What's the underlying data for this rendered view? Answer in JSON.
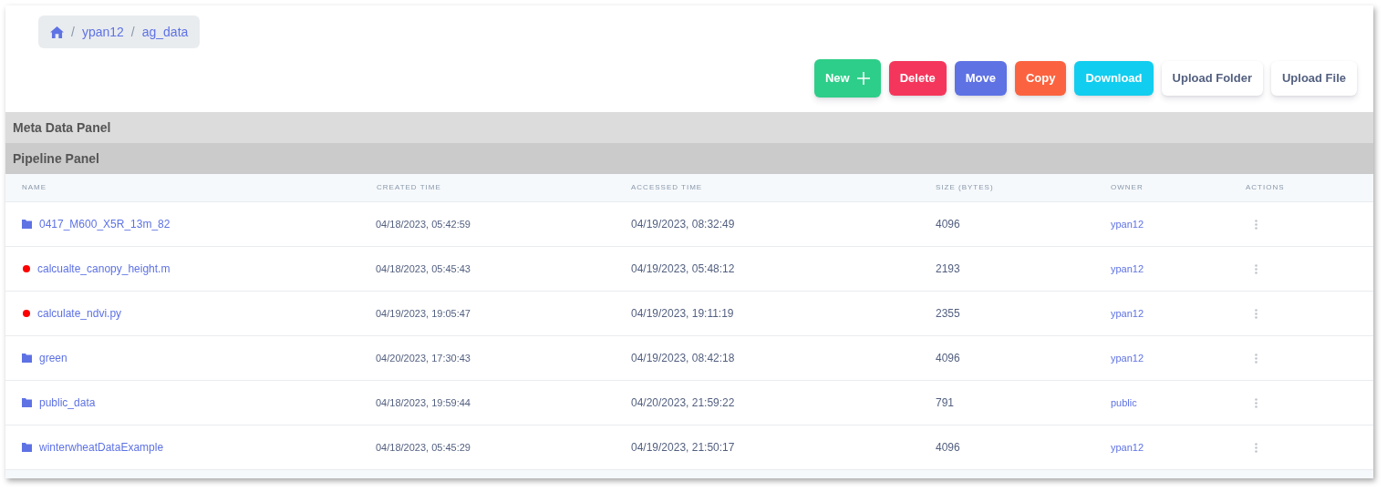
{
  "breadcrumb": {
    "items": [
      {
        "kind": "home"
      },
      {
        "kind": "separator",
        "label": "/"
      },
      {
        "kind": "link",
        "label": "ypan12"
      },
      {
        "kind": "separator",
        "label": "/"
      },
      {
        "kind": "link",
        "label": "ag_data"
      }
    ]
  },
  "toolbar": {
    "buttons": [
      {
        "label": "New",
        "kind": "new"
      },
      {
        "label": "Delete",
        "kind": "danger"
      },
      {
        "label": "Move",
        "kind": "indigo"
      },
      {
        "label": "Copy",
        "kind": "orange"
      },
      {
        "label": "Download",
        "kind": "cyan"
      },
      {
        "label": "Upload Folder",
        "kind": "plain"
      },
      {
        "label": "Upload File",
        "kind": "plain"
      }
    ]
  },
  "panels": [
    {
      "title": "Meta Data Panel",
      "kind": "light"
    },
    {
      "title": "Pipeline Panel",
      "kind": "dark"
    }
  ],
  "table": {
    "columns": [
      "NAME",
      "CREATED TIME",
      "ACCESSED TIME",
      "SIZE (BYTES)",
      "OWNER",
      "ACTIONS"
    ],
    "rows": [
      {
        "kind": "folder",
        "name": "0417_M600_X5R_13m_82",
        "created": "04/18/2023, 05:42:59",
        "accessed": "04/19/2023, 08:32:49",
        "size": "4096",
        "owner": "ypan12"
      },
      {
        "kind": "file",
        "name": "calcualte_canopy_height.m",
        "created": "04/18/2023, 05:45:43",
        "accessed": "04/19/2023, 05:48:12",
        "size": "2193",
        "owner": "ypan12"
      },
      {
        "kind": "file",
        "name": "calculate_ndvi.py",
        "created": "04/19/2023, 19:05:47",
        "accessed": "04/19/2023, 19:11:19",
        "size": "2355",
        "owner": "ypan12"
      },
      {
        "kind": "folder",
        "name": "green",
        "created": "04/20/2023, 17:30:43",
        "accessed": "04/19/2023, 08:42:18",
        "size": "4096",
        "owner": "ypan12"
      },
      {
        "kind": "folder",
        "name": "public_data",
        "created": "04/18/2023, 19:59:44",
        "accessed": "04/20/2023, 21:59:22",
        "size": "791",
        "owner": "public"
      },
      {
        "kind": "folder",
        "name": "winterwheatDataExample",
        "created": "04/18/2023, 05:45:29",
        "accessed": "04/19/2023, 21:50:17",
        "size": "4096",
        "owner": "ypan12"
      }
    ]
  }
}
